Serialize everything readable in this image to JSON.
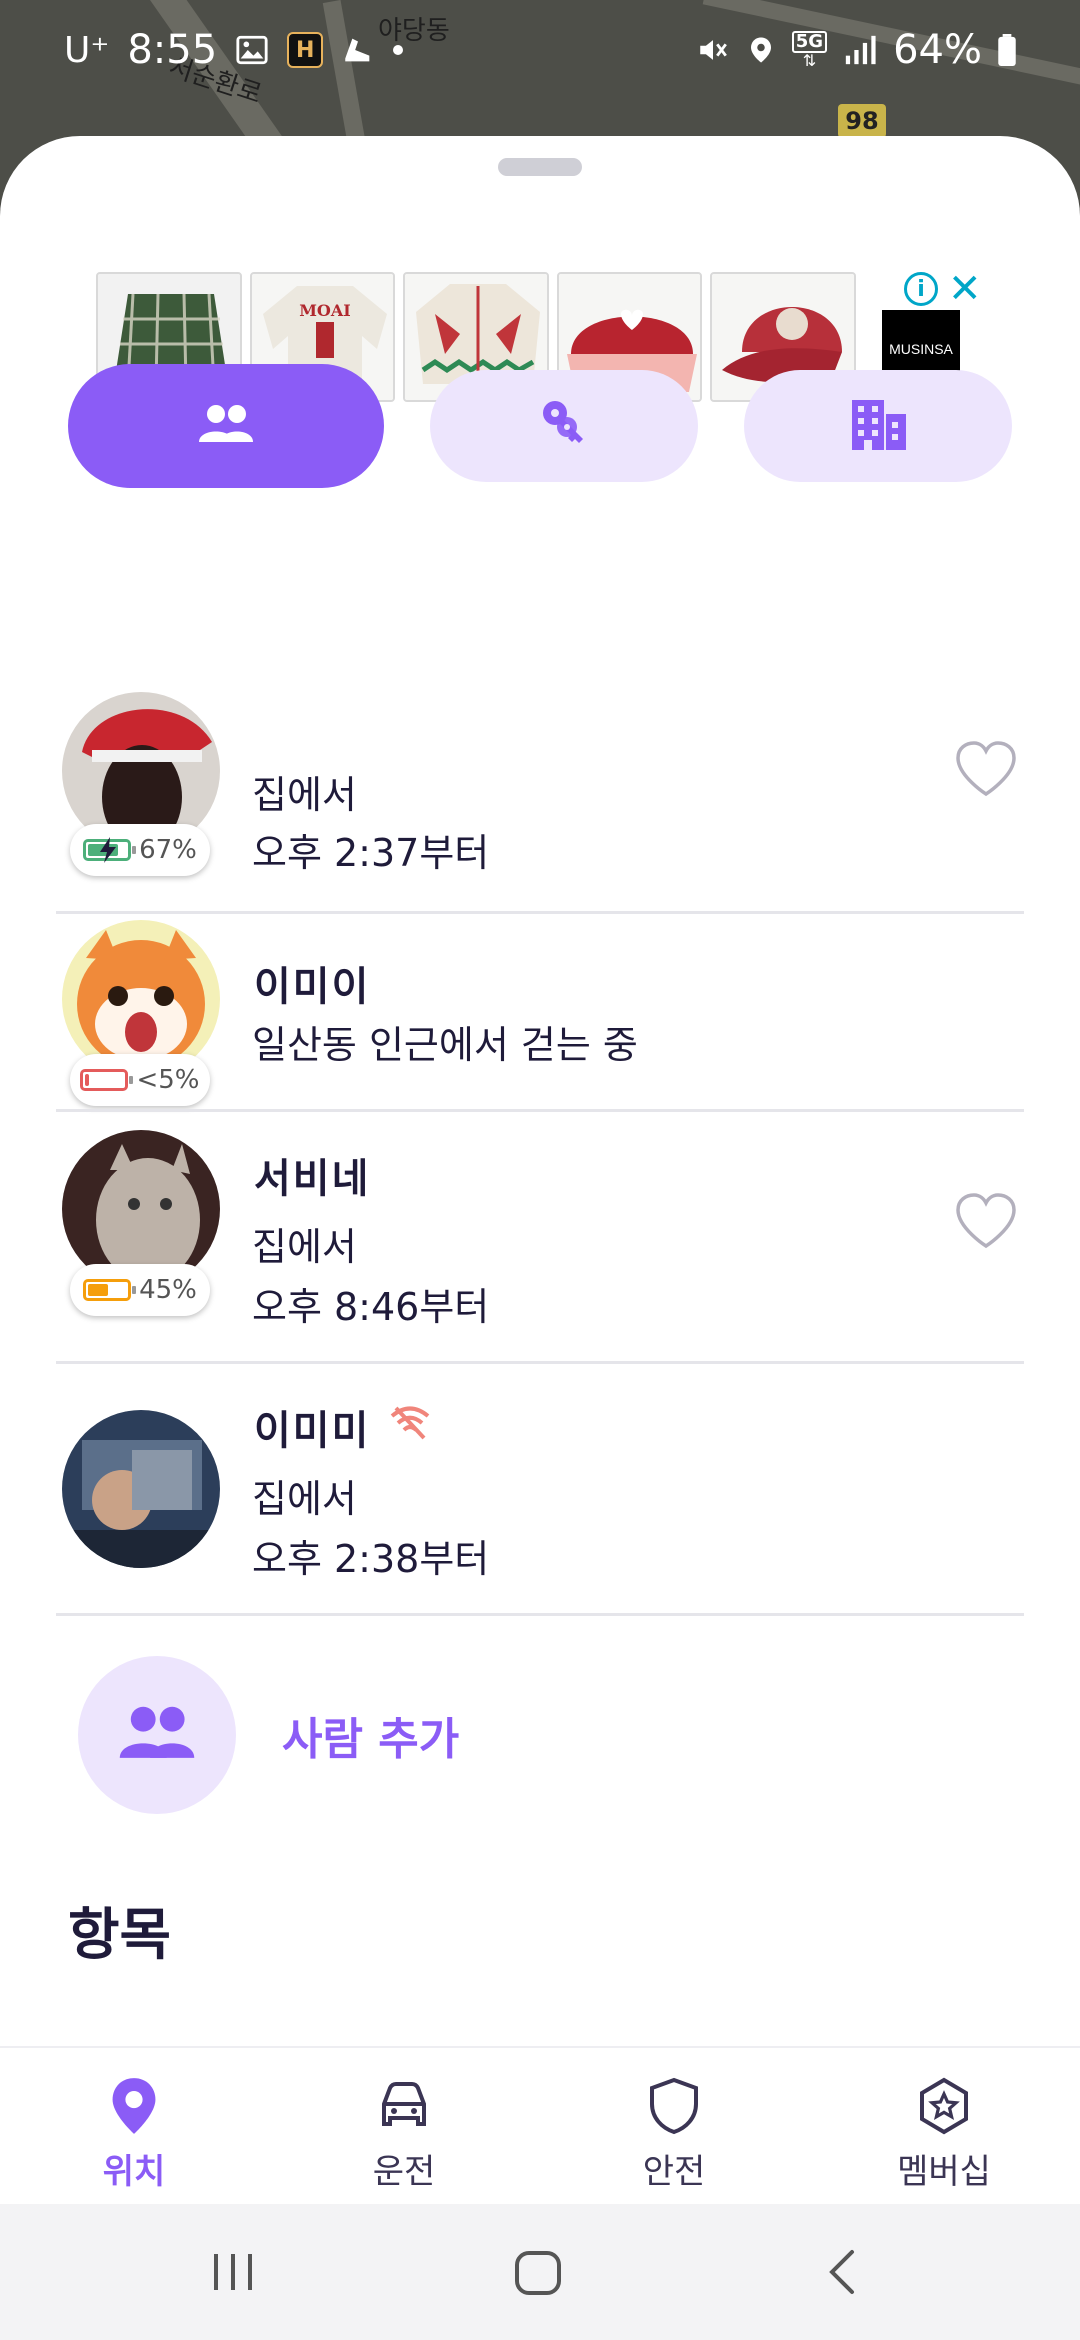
{
  "status_bar": {
    "carrier": "U⁺",
    "time": "8:55",
    "h_badge": "H",
    "network": "5G",
    "battery": "64%"
  },
  "map": {
    "labels": [
      "야당동",
      "서순환로"
    ],
    "route_number": "98"
  },
  "ad": {
    "brand": "MUSINSA",
    "products": [
      "plaid-shirt",
      "sweatshirt",
      "knit-cardigan",
      "pink-cap",
      "red-cap"
    ],
    "product_texts": [
      "MOAI"
    ]
  },
  "tabs": {
    "people": "people-icon",
    "items": "keys-icon",
    "places": "building-icon"
  },
  "members": [
    {
      "name": "",
      "status": "집에서",
      "since": "오후 2:37부터",
      "battery": "67%",
      "battery_level": 0.67,
      "charging": true,
      "battery_color": "#4caf7a",
      "favorite": false
    },
    {
      "name": "이미이",
      "status": "일산동 인근에서 걷는 중",
      "since": "",
      "battery": "<5%",
      "battery_level": 0.05,
      "charging": false,
      "battery_color": "#e45b5b",
      "favorite": null
    },
    {
      "name": "서비네",
      "status": "집에서",
      "since": "오후 8:46부터",
      "battery": "45%",
      "battery_level": 0.45,
      "charging": false,
      "battery_color": "#f59e0b",
      "favorite": false
    },
    {
      "name": "이미미",
      "status": "집에서",
      "since": "오후 2:38부터",
      "battery": "",
      "offline": true,
      "favorite": null
    }
  ],
  "add_person": {
    "label": "사람 추가"
  },
  "section_title": "항목",
  "bottom_nav": [
    {
      "label": "위치",
      "icon": "location-pin-icon",
      "active": true
    },
    {
      "label": "운전",
      "icon": "car-icon",
      "active": false
    },
    {
      "label": "안전",
      "icon": "shield-icon",
      "active": false
    },
    {
      "label": "멤버십",
      "icon": "star-badge-icon",
      "active": false
    }
  ],
  "colors": {
    "accent": "#8b5cf6",
    "accent_light": "#ede5fd",
    "text_dark": "#1f1b3a"
  }
}
